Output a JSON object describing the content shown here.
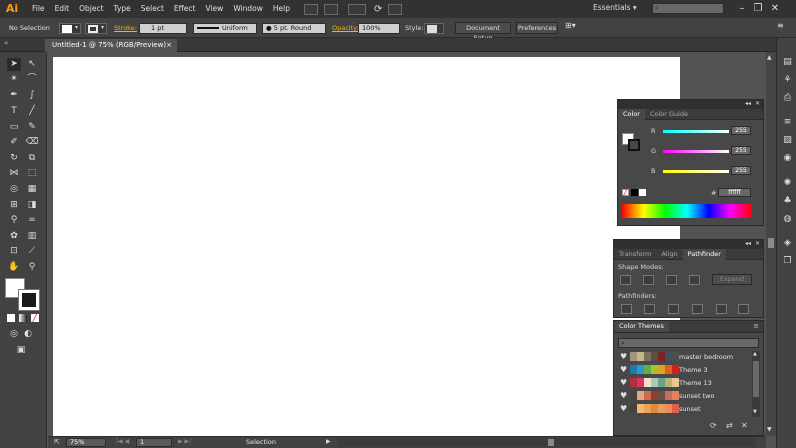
{
  "app": {
    "logo": "Ai"
  },
  "menu": [
    "File",
    "Edit",
    "Object",
    "Type",
    "Select",
    "Effect",
    "View",
    "Window",
    "Help"
  ],
  "workspace": {
    "label": "Essentials"
  },
  "control_bar": {
    "selection_label": "No Selection",
    "stroke_label": "Stroke:",
    "stroke_weight": "1 pt",
    "profile": "Uniform",
    "brush": "5 pt. Round",
    "opacity_label": "Opacity:",
    "opacity_value": "100%",
    "style_label": "Style:",
    "document_setup": "Document Setup",
    "preferences": "Preferences"
  },
  "document_tab": {
    "title": "Untitled-1 @ 75% (RGB/Preview)",
    "close": "×"
  },
  "status_bar": {
    "zoom": "75%",
    "artboard": "1",
    "tool": "Selection"
  },
  "color_panel": {
    "tabs": [
      "Color",
      "Color Guide"
    ],
    "channels": [
      {
        "label": "R",
        "value": "255",
        "color": "#e02020"
      },
      {
        "label": "G",
        "value": "255",
        "color": "#20c020"
      },
      {
        "label": "B",
        "value": "255",
        "color": "#2040e0"
      }
    ],
    "hex_label": "#",
    "hex_value": "ffffff"
  },
  "pathfinder_panel": {
    "tabs": [
      "Transform",
      "Align",
      "Pathfinder"
    ],
    "shape_modes_label": "Shape Modes:",
    "pathfinders_label": "Pathfinders:",
    "expand": "Expand"
  },
  "color_themes_panel": {
    "title": "Color Themes",
    "themes": [
      {
        "name": "master bedroom",
        "colors": [
          "#a09680",
          "#c8b888",
          "#7a7060",
          "#5a5040",
          "#7c2424",
          "#405060",
          "#4a5050"
        ]
      },
      {
        "name": "Theme 3",
        "colors": [
          "#1e7aa8",
          "#2a9ad0",
          "#60b040",
          "#a8c030",
          "#e0a020",
          "#e06020",
          "#d02020"
        ]
      },
      {
        "name": "Theme 13",
        "colors": [
          "#b03040",
          "#e03060",
          "#f0e0d0",
          "#a8c8b8",
          "#6aa090",
          "#c0b070",
          "#e8c890"
        ]
      },
      {
        "name": "sunset two",
        "colors": [
          "#424242",
          "#e0a880",
          "#d06850",
          "#8a4030",
          "#6a5040",
          "#c07060",
          "#e88060"
        ]
      },
      {
        "name": "sunset",
        "colors": [
          "#424242",
          "#f0b870",
          "#f0a050",
          "#e08840",
          "#e0a060",
          "#f08860",
          "#e06050"
        ]
      }
    ]
  }
}
